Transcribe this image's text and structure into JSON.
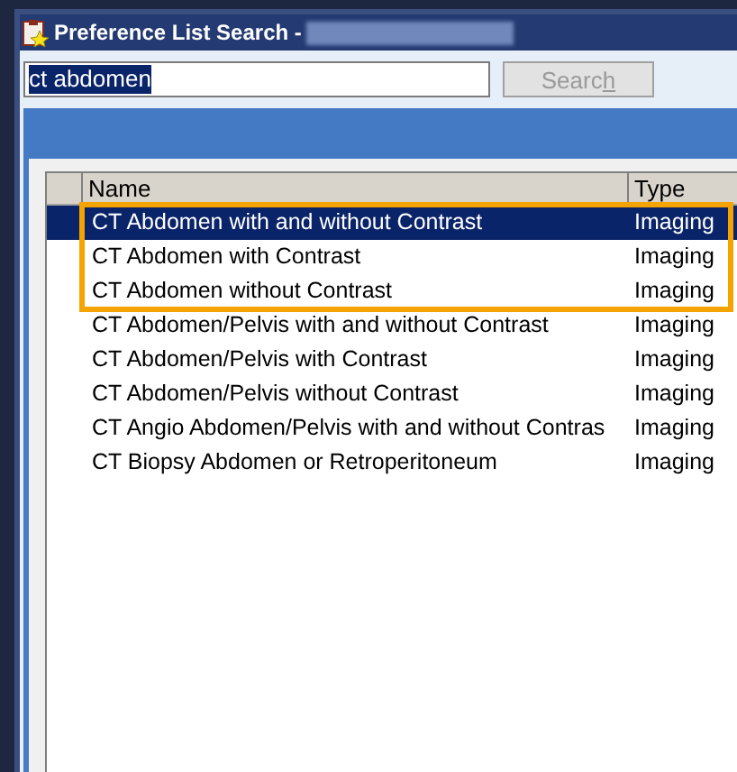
{
  "window": {
    "title": "Preference List Search -"
  },
  "search": {
    "value": "ct abdomen",
    "text_selected": true
  },
  "search_button": {
    "label_before": "Searc",
    "access_key": "h",
    "disabled": true
  },
  "table": {
    "columns": [
      "Name",
      "Type"
    ],
    "rows": [
      {
        "name": "CT Abdomen with and without Contrast",
        "type": "Imaging",
        "selected": true,
        "outlined": true
      },
      {
        "name": "CT Abdomen with Contrast",
        "type": "Imaging",
        "selected": false,
        "outlined": true
      },
      {
        "name": "CT Abdomen without Contrast",
        "type": "Imaging",
        "selected": false,
        "outlined": true
      },
      {
        "name": "CT Abdomen/Pelvis with and without Contrast",
        "type": "Imaging",
        "selected": false,
        "outlined": false
      },
      {
        "name": "CT Abdomen/Pelvis with Contrast",
        "type": "Imaging",
        "selected": false,
        "outlined": false
      },
      {
        "name": "CT Abdomen/Pelvis without Contrast",
        "type": "Imaging",
        "selected": false,
        "outlined": false
      },
      {
        "name": "CT Angio Abdomen/Pelvis with and without Contras",
        "type": "Imaging",
        "selected": false,
        "outlined": false
      },
      {
        "name": "CT Biopsy Abdomen or Retroperitoneum",
        "type": "Imaging",
        "selected": false,
        "outlined": false
      }
    ]
  }
}
